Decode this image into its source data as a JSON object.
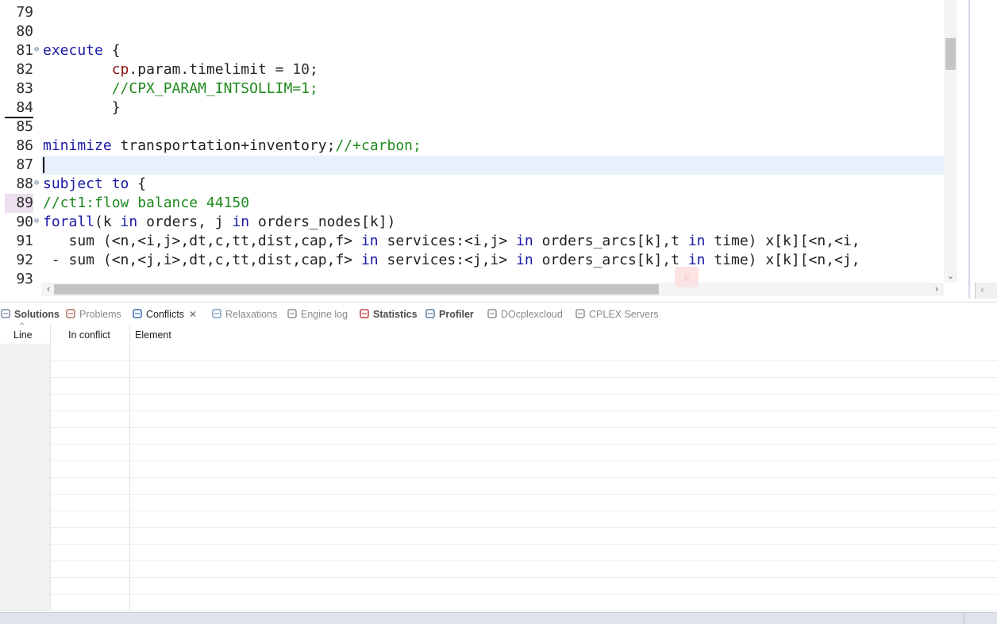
{
  "editor": {
    "lines": [
      {
        "n": "79",
        "parts": []
      },
      {
        "n": "80",
        "parts": []
      },
      {
        "n": "81",
        "fold": true,
        "parts": [
          {
            "t": "execute",
            "c": "kw"
          },
          {
            "t": " {",
            "c": ""
          }
        ]
      },
      {
        "n": "82",
        "parts": [
          {
            "t": "        ",
            "c": ""
          },
          {
            "t": "cp",
            "c": "fld"
          },
          {
            "t": ".param.timelimit = ",
            "c": ""
          },
          {
            "t": "10",
            "c": "num"
          },
          {
            "t": ";",
            "c": ""
          }
        ]
      },
      {
        "n": "83",
        "parts": [
          {
            "t": "        ",
            "c": ""
          },
          {
            "t": "//CPX_PARAM_INTSOLLIM=1;",
            "c": "cm"
          }
        ]
      },
      {
        "n": "84",
        "parts": [
          {
            "t": "        }",
            "c": ""
          }
        ]
      },
      {
        "n": "85",
        "parts": []
      },
      {
        "n": "86",
        "parts": [
          {
            "t": "minimize",
            "c": "kw"
          },
          {
            "t": " transportation+inventory;",
            "c": ""
          },
          {
            "t": "//+carbon;",
            "c": "cm"
          }
        ]
      },
      {
        "n": "87",
        "parts": []
      },
      {
        "n": "88",
        "fold": true,
        "parts": [
          {
            "t": "subject to",
            "c": "kw"
          },
          {
            "t": " {",
            "c": ""
          }
        ]
      },
      {
        "n": "89",
        "parts": [
          {
            "t": "//ct1:flow balance 44150",
            "c": "cm"
          }
        ]
      },
      {
        "n": "90",
        "fold": true,
        "parts": [
          {
            "t": "forall",
            "c": "kw"
          },
          {
            "t": "(k ",
            "c": ""
          },
          {
            "t": "in",
            "c": "kw"
          },
          {
            "t": " orders, j ",
            "c": ""
          },
          {
            "t": "in",
            "c": "kw"
          },
          {
            "t": " orders_nodes[k])",
            "c": ""
          }
        ]
      },
      {
        "n": "91",
        "parts": [
          {
            "t": "   sum (<n,<i,j>,dt,c,tt,dist,cap,f> ",
            "c": ""
          },
          {
            "t": "in",
            "c": "kw"
          },
          {
            "t": " services:<i,j> ",
            "c": ""
          },
          {
            "t": "in",
            "c": "kw"
          },
          {
            "t": " orders_arcs[k],t ",
            "c": ""
          },
          {
            "t": "in",
            "c": "kw"
          },
          {
            "t": " time) x[k][<n,<i,",
            "c": ""
          }
        ]
      },
      {
        "n": "92",
        "parts": [
          {
            "t": " - sum (<n,<j,i>,dt,c,tt,dist,cap,f> ",
            "c": ""
          },
          {
            "t": "in",
            "c": "kw"
          },
          {
            "t": " services:<j,i> ",
            "c": ""
          },
          {
            "t": "in",
            "c": "kw"
          },
          {
            "t": " orders_arcs[k],t ",
            "c": ""
          },
          {
            "t": "in",
            "c": "kw"
          },
          {
            "t": " time) x[k][<n,<j,",
            "c": ""
          }
        ]
      },
      {
        "n": "93",
        "parts": []
      }
    ],
    "colors": {
      "keyword": "#1a1aa6",
      "comment": "#1f8a1f",
      "field": "#8a1010",
      "current_line": "#e8f0fb"
    }
  },
  "panel": {
    "tabs": [
      {
        "label": "Solutions",
        "icon": "solutions-icon",
        "style": "bold"
      },
      {
        "label": "Problems",
        "icon": "problems-icon",
        "style": ""
      },
      {
        "label": "Conflicts",
        "icon": "conflicts-icon",
        "style": "active",
        "close": "✕"
      },
      {
        "label": "Relaxations",
        "icon": "relaxations-icon",
        "style": ""
      },
      {
        "label": "Engine log",
        "icon": "engine-log-icon",
        "style": ""
      },
      {
        "label": "Statistics",
        "icon": "statistics-icon",
        "style": "bold"
      },
      {
        "label": "Profiler",
        "icon": "profiler-icon",
        "style": "bold"
      },
      {
        "label": "DOcplexcloud",
        "icon": "docplexcloud-icon",
        "style": ""
      },
      {
        "label": "CPLEX Servers",
        "icon": "cplex-servers-icon",
        "style": ""
      }
    ],
    "columns": {
      "line": "Line",
      "in_conflict": "In conflict",
      "element": "Element"
    }
  }
}
